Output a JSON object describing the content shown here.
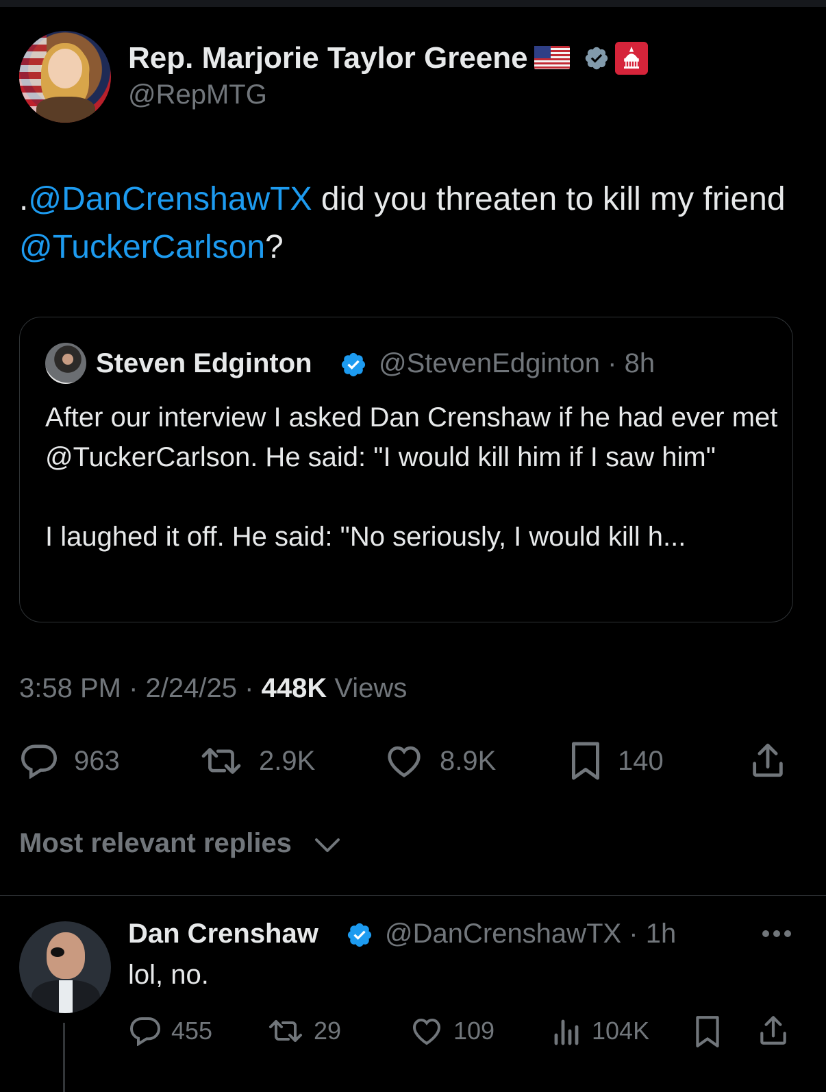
{
  "tweet": {
    "author_name": "Rep. Marjorie Taylor Greene",
    "author_handle": "@RepMTG",
    "text_prefix": ".",
    "mention_1": "@DanCrenshawTX",
    "text_middle": " did you threaten to kill my friend ",
    "mention_2": "@TuckerCarlson",
    "text_suffix": "?",
    "time": "3:58 PM",
    "date": "2/24/25",
    "views_count": "448K",
    "views_label": "Views",
    "meta_separator": "·",
    "stats": {
      "replies": "963",
      "reposts": "2.9K",
      "likes": "8.9K",
      "bookmarks": "140"
    }
  },
  "quote": {
    "author_name": "Steven Edginton",
    "author_handle": "@StevenEdginton · 8h",
    "paragraph_1": "After our interview I asked Dan Crenshaw if he had ever met @TuckerCarlson. He said: \"I would kill him if I saw him\"",
    "paragraph_2": "I laughed it off. He said: \"No seriously, I would kill h..."
  },
  "replies_section": {
    "sort_label": "Most relevant replies"
  },
  "reply": {
    "author_name": "Dan Crenshaw",
    "author_handle": "@DanCrenshawTX · 1h",
    "text": "lol, no.",
    "stats": {
      "replies": "455",
      "reposts": "29",
      "likes": "109",
      "views": "104K"
    }
  },
  "colors": {
    "background": "#000000",
    "text_primary": "#e7e9ea",
    "text_secondary": "#71767b",
    "link": "#1d9bf0",
    "verified": "#1d9bf0",
    "border": "#2f3336"
  },
  "icons": {
    "reply": "reply-icon",
    "repost": "repost-icon",
    "like": "heart-icon",
    "bookmark": "bookmark-icon",
    "share": "share-icon",
    "views": "views-icon",
    "more": "more-icon",
    "verified": "verified-badge-icon",
    "flag": "us-flag-icon",
    "affiliation": "capitol-badge-icon"
  }
}
